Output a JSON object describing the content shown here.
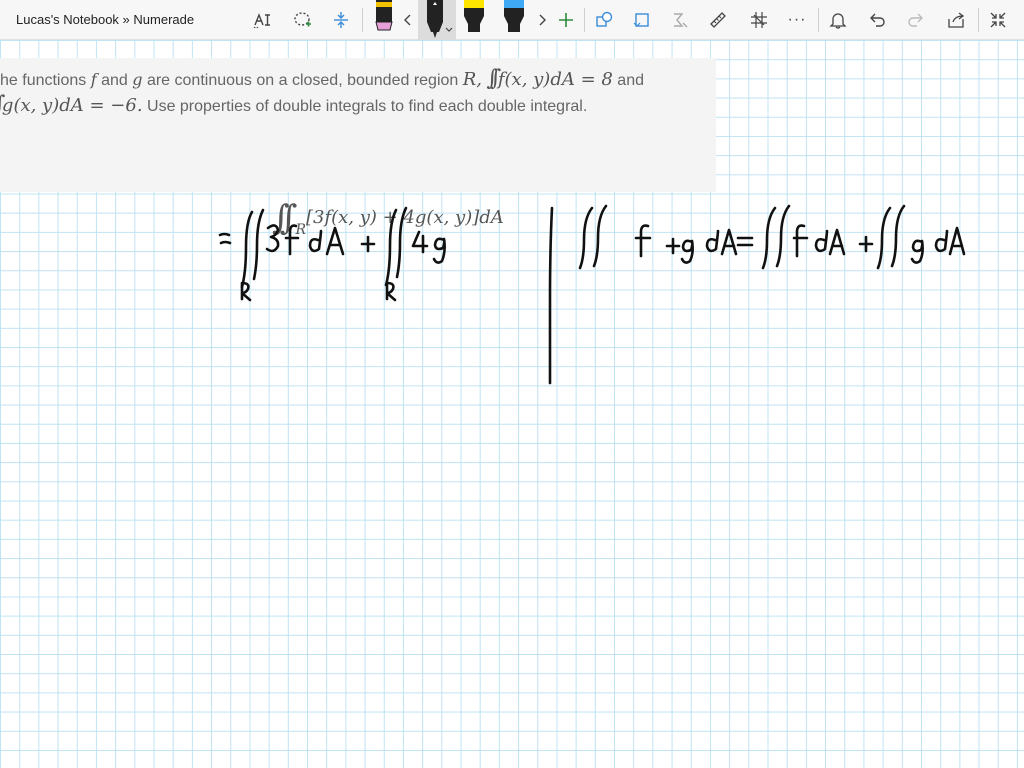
{
  "window": {
    "title": "Lucas's Notebook » Numerade"
  },
  "problem": {
    "line1_prefix": "he functions ",
    "f": "f",
    "and1": " and ",
    "g": "g",
    "line1_mid": " are continuous on a closed, bounded region ",
    "R": "R,",
    "integral1": "f(x, y)dA = 8",
    "and2": " and",
    "integral2": "g(x, y)dA = −6.",
    "line2_rest": " Use properties of double integrals to find each double integral.",
    "formula": "[3f(x, y) + 4g(x, y)]dA",
    "formula_sub": "R"
  },
  "toolbar": {
    "icons": [
      "lasso-text-icon",
      "lasso-select-icon",
      "insert-space-icon",
      "pen-pink-icon",
      "chevron-left-icon",
      "pen-black-icon",
      "highlighter-yellow-icon",
      "highlighter-blue-icon",
      "chevron-right-icon",
      "add-pen-icon",
      "shapes-icon",
      "ink-to-shape-icon",
      "ink-to-math-icon",
      "ruler-icon",
      "ink-eraser-icon",
      "more-icon",
      "bell-icon",
      "undo-icon",
      "redo-icon",
      "share-icon",
      "collapse-icon"
    ],
    "more_label": "···"
  },
  "colors": {
    "grid": "#bfe3f3",
    "ink": "#111111",
    "problem_bg": "#f4f4f4",
    "problem_text": "#666666",
    "highlighter_yellow": "#ffe400",
    "highlighter_blue": "#3fa9f5",
    "pen_pink": "#e8a0d8"
  }
}
